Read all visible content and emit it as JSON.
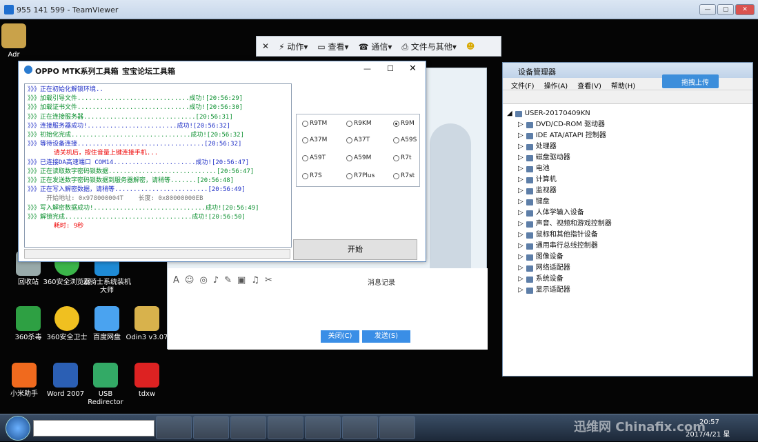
{
  "tv": {
    "title": "955 141 599 - TeamViewer",
    "tool_action": "动作",
    "tool_view": "查看",
    "tool_comm": "通信",
    "tool_file": "文件与其他"
  },
  "desktop": {
    "icons": [
      {
        "label": "回收站"
      },
      {
        "label": "360安全浏览器"
      },
      {
        "label": "云骑士系统装机大师"
      },
      {
        "label": "360杀毒"
      },
      {
        "label": "360安全卫士"
      },
      {
        "label": "百度网盘"
      },
      {
        "label": "Odin3 v3.07"
      },
      {
        "label": "小米助手"
      },
      {
        "label": "Word 2007"
      },
      {
        "label": "USB Redirector"
      },
      {
        "label": "tdxw"
      }
    ],
    "partial": "Adr"
  },
  "tool": {
    "title": "OPPO MTK系列工具箱",
    "subtitle": "宝宝论坛工具箱",
    "start": "开始",
    "log": [
      {
        "t": "》》》正在初始化解锁环境..",
        "c": "b"
      },
      {
        "t": "》》》加载引导文件..............................成功![20:56:29]",
        "c": "g"
      },
      {
        "t": "》》》加载证书文件..............................成功![20:56:30]",
        "c": "g"
      },
      {
        "t": "》》》正在连接服务器..............................[20:56:31]",
        "c": "g"
      },
      {
        "t": "》》》连接服务器成功!........................成功![20:56:32]",
        "c": "b"
      },
      {
        "t": "》》》初始化完成................................成功![20:56:32]",
        "c": "g"
      },
      {
        "t": "》》》等待设备连接..................................[20:56:32]",
        "c": "b"
      },
      {
        "t": "       请关机后，按住音量上键连接手机...",
        "c": "r"
      },
      {
        "t": "》》》已连接DA高速端口 COM14......................成功![20:56:47]",
        "c": "b"
      },
      {
        "t": "》》》正在读取数字密码锁数据.............................[20:56:47]",
        "c": "g"
      },
      {
        "t": "》》》正在发送数字密码锁数据到服务器解密，请稍等.......[20:56:48]",
        "c": "g"
      },
      {
        "t": "》》》正在写入解密数据，请稍等.........................[20:56:49]",
        "c": "b"
      },
      {
        "t": "     开始地址: 0x978000004T    长度: 0x80000000EB",
        "c": "gr"
      },
      {
        "t": "》》》写入解密数据成功!..............................成功![20:56:49]",
        "c": "g"
      },
      {
        "t": "》》》解锁完成..................................成功![20:56:50]",
        "c": "g"
      },
      {
        "t": "       耗时: 9秒",
        "c": "r"
      }
    ],
    "models": [
      "R9TM",
      "R9KM",
      "R9M",
      "A37M",
      "A37T",
      "A59S",
      "A59T",
      "A59M",
      "R7t",
      "R7S",
      "R7Plus",
      "R7st"
    ],
    "selected": "R9M"
  },
  "qq": {
    "close": "关闭(C)",
    "send": "发送(S)",
    "history": "消息记录"
  },
  "devmgr": {
    "title": "设备管理器",
    "menu": [
      "文件(F)",
      "操作(A)",
      "查看(V)",
      "帮助(H)"
    ],
    "root": "USER-20170409KN",
    "items": [
      "DVD/CD-ROM 驱动器",
      "IDE ATA/ATAPI 控制器",
      "处理器",
      "磁盘驱动器",
      "电池",
      "计算机",
      "监视器",
      "键盘",
      "人体学输入设备",
      "声音、视频和游戏控制器",
      "鼠标和其他指针设备",
      "通用串行总线控制器",
      "图像设备",
      "网络适配器",
      "系统设备",
      "显示适配器"
    ]
  },
  "upload": "拖拽上传",
  "clock": {
    "time": "20:57",
    "date": "2017/4/21 星"
  },
  "watermark": "迅维网 Chinafix.com"
}
